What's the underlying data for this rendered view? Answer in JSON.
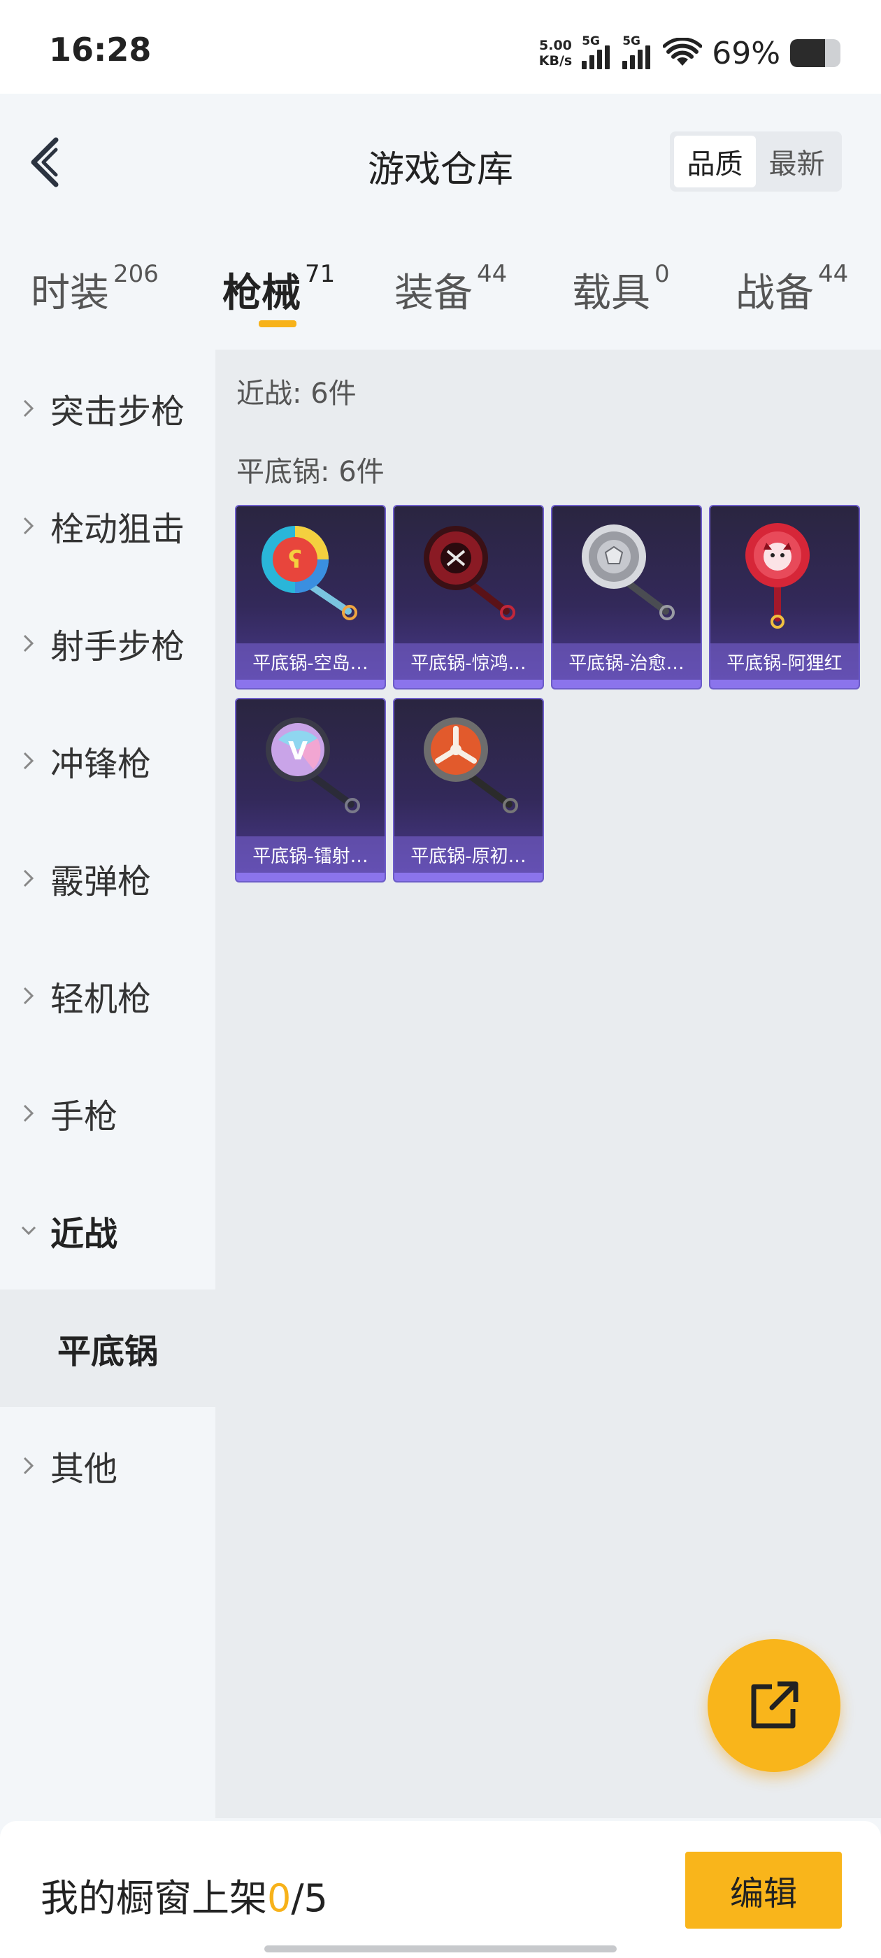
{
  "status_bar": {
    "time": "16:28",
    "net_speed_value": "5.00",
    "net_speed_unit": "KB/s",
    "sig1_label": "5G",
    "sig2_label": "5G",
    "battery_percent": "69%"
  },
  "header": {
    "title": "游戏仓库",
    "sort_options": [
      "品质",
      "最新"
    ],
    "active_sort": "品质"
  },
  "tabs": [
    {
      "label": "时装",
      "count": "206"
    },
    {
      "label": "枪械",
      "count": "71"
    },
    {
      "label": "装备",
      "count": "44"
    },
    {
      "label": "载具",
      "count": "0"
    },
    {
      "label": "战备",
      "count": "44"
    }
  ],
  "active_tab": "枪械",
  "sidebar": {
    "items": [
      {
        "label": "突击步枪"
      },
      {
        "label": "栓动狙击"
      },
      {
        "label": "射手步枪"
      },
      {
        "label": "冲锋枪"
      },
      {
        "label": "霰弹枪"
      },
      {
        "label": "轻机枪"
      },
      {
        "label": "手枪"
      },
      {
        "label": "近战"
      },
      {
        "label": "其他"
      }
    ],
    "expanded": "近战",
    "sub_selected": "平底锅"
  },
  "content": {
    "category_title": "近战: 6件",
    "group_title": "平底锅: 6件",
    "items": [
      {
        "name": "平底锅-空岛…",
        "icon": "frying-pan-skyisland-icon",
        "color": "#e8453c"
      },
      {
        "name": "平底锅-惊鸿…",
        "icon": "frying-pan-jinghong-icon",
        "color": "#8a1a24"
      },
      {
        "name": "平底锅-治愈…",
        "icon": "frying-pan-healing-icon",
        "color": "#b9bcc3"
      },
      {
        "name": "平底锅-阿狸红",
        "icon": "frying-pan-ali-red-icon",
        "color": "#d62638"
      },
      {
        "name": "平底锅-镭射…",
        "icon": "frying-pan-laser-icon",
        "color": "#c9a4e8"
      },
      {
        "name": "平底锅-原初…",
        "icon": "frying-pan-origin-icon",
        "color": "#e25a2c"
      }
    ]
  },
  "bottom_bar": {
    "shelf_label": "我的橱窗上架",
    "shelf_current": "0",
    "shelf_total": "/5",
    "edit_label": "编辑"
  },
  "colors": {
    "accent": "#f9b51b",
    "card_border": "#6d5dc9"
  }
}
